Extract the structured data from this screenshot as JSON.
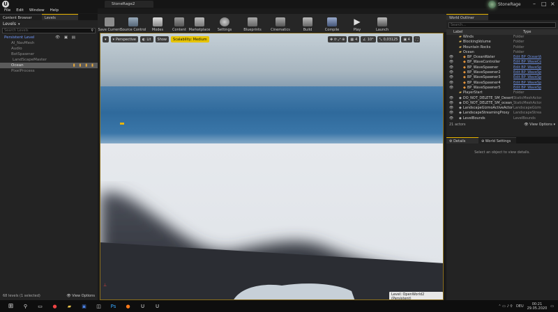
{
  "window": {
    "title": "StoneRage2",
    "project": "StoneRage"
  },
  "menu": [
    "File",
    "Edit",
    "Window",
    "Help"
  ],
  "left_tabs": {
    "content_browser": "Content Browser",
    "levels": "Levels"
  },
  "levels": {
    "menu_label": "Levels",
    "search_placeholder": "Search Levels",
    "rows": [
      "Persistent Level",
      "AI_NavMesh",
      "Audio",
      "BotSpawner",
      "LandScapeMaster",
      "Ocean",
      "PixelProcess"
    ],
    "status": "68 levels (1 selected)",
    "view_options": "View Options"
  },
  "toolbar": [
    "Save Current",
    "Source Control",
    "Modes",
    "Content",
    "Marketplace",
    "Settings",
    "Blueprints",
    "Cinematics",
    "Build",
    "Compile",
    "Play",
    "Launch"
  ],
  "viewport": {
    "perspective": "Perspective",
    "lit": "Lit",
    "show": "Show",
    "scalability": "Scalability: Medium",
    "snap_value": "0,03125",
    "grid_value": "4",
    "level_label": "Level:",
    "level_name": "OpenWorld2 (Persistent)"
  },
  "outliner": {
    "tab": "World Outliner",
    "search_placeholder": "Search...",
    "col_label": "Label",
    "col_type": "Type",
    "rows": [
      {
        "label": "Winds",
        "type": "Folder",
        "indent": 1,
        "kind": "folder"
      },
      {
        "label": "BlockingVolume",
        "type": "Folder",
        "indent": 1,
        "kind": "folder"
      },
      {
        "label": "Mountain Rocks",
        "type": "Folder",
        "indent": 1,
        "kind": "folder"
      },
      {
        "label": "Ocean",
        "type": "Folder",
        "indent": 1,
        "kind": "folder"
      },
      {
        "label": "BP_OceanWater",
        "type": "Edit BP_OceanW",
        "indent": 2,
        "kind": "bp",
        "link": true
      },
      {
        "label": "BP_WaveController",
        "type": "Edit BP_WaveCo",
        "indent": 2,
        "kind": "bp",
        "link": true
      },
      {
        "label": "BP_WaveSpawner",
        "type": "Edit BP_WaveSp",
        "indent": 2,
        "kind": "bp",
        "link": true
      },
      {
        "label": "BP_WaveSpawner2",
        "type": "Edit BP_WaveSp",
        "indent": 2,
        "kind": "bp",
        "link": true
      },
      {
        "label": "BP_WaveSpawner3",
        "type": "Edit BP_WaveSp",
        "indent": 2,
        "kind": "bp",
        "link": true
      },
      {
        "label": "BP_WaveSpawner4",
        "type": "Edit BP_WaveSp",
        "indent": 2,
        "kind": "bp",
        "link": true
      },
      {
        "label": "BP_WaveSpawner5",
        "type": "Edit BP_WaveSp",
        "indent": 2,
        "kind": "bp",
        "link": true
      },
      {
        "label": "PlayerStart",
        "type": "Folder",
        "indent": 1,
        "kind": "folder"
      },
      {
        "label": "DO_NOT_DELETE_SM_Desert_Rock",
        "type": "StaticMeshActor",
        "indent": 1,
        "kind": "mesh"
      },
      {
        "label": "DO_NOT_DELETE_SM_ocean_sand",
        "type": "StaticMeshActor",
        "indent": 1,
        "kind": "mesh"
      },
      {
        "label": "LandscapeGizmoActiveActor",
        "type": "LandscapeGizmoA",
        "indent": 1,
        "kind": "mesh"
      },
      {
        "label": "LandscapeStreamingProxy",
        "type": "LandscapeStreamin",
        "indent": 1,
        "kind": "mesh"
      },
      {
        "label": "LevelBounds",
        "type": "LevelBounds",
        "indent": 1,
        "kind": "mesh"
      }
    ],
    "actors": "21 actors",
    "view_options": "View Options"
  },
  "details": {
    "tab": "Details",
    "world_settings": "World Settings",
    "empty": "Select an object to view details."
  },
  "taskbar": {
    "time": "00:21",
    "date": "29.05.2020",
    "lang": "DEU"
  },
  "colors": {
    "accent": "#e8b400",
    "link": "#6d8fe0",
    "scalability_bg": "#e6c300"
  }
}
